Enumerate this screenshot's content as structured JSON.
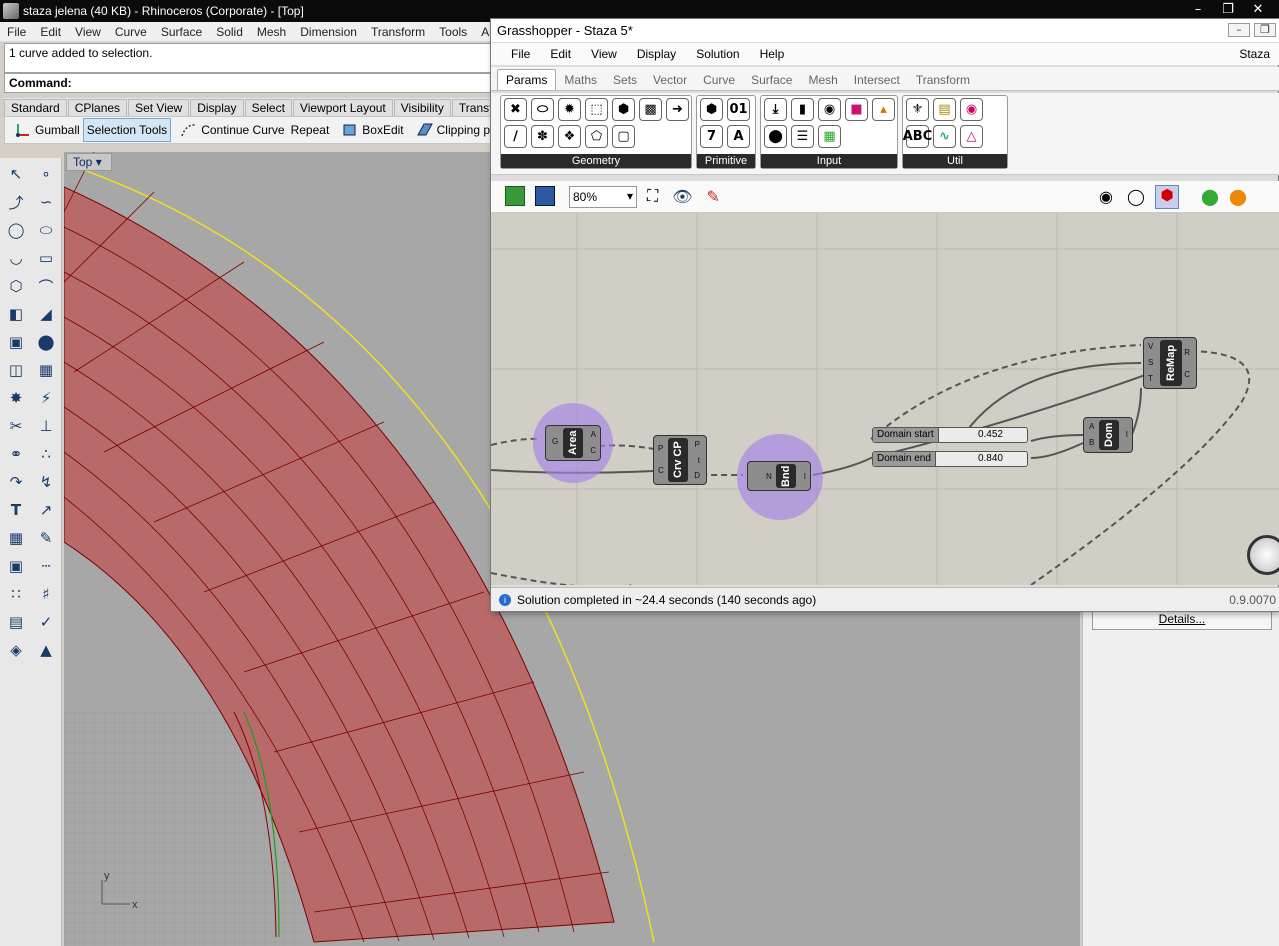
{
  "rhino": {
    "title": "staza jelena (40 KB) - Rhinoceros (Corporate) - [Top]",
    "menu": [
      "File",
      "Edit",
      "View",
      "Curve",
      "Surface",
      "Solid",
      "Mesh",
      "Dimension",
      "Transform",
      "Tools",
      "An"
    ],
    "history": "1 curve added to selection.",
    "command_label": "Command:",
    "toolbar_tabs": [
      "Standard",
      "CPlanes",
      "Set View",
      "Display",
      "Select",
      "Viewport Layout",
      "Visibility",
      "Transfor"
    ],
    "tools": {
      "gumball": "Gumball",
      "selection": "Selection Tools",
      "continue": "Continue Curve",
      "repeat": "Repeat",
      "boxedit": "BoxEdit",
      "clipping": "Clipping pl"
    },
    "viewport_tab": "Top",
    "axis_x": "x",
    "axis_y": "y",
    "details_button": "Details..."
  },
  "gh": {
    "title": "Grasshopper - Staza 5*",
    "title_right": "Staza",
    "menu": [
      "File",
      "Edit",
      "View",
      "Display",
      "Solution",
      "Help"
    ],
    "tabs": [
      "Params",
      "Maths",
      "Sets",
      "Vector",
      "Curve",
      "Surface",
      "Mesh",
      "Intersect",
      "Transform"
    ],
    "groups": [
      "Geometry",
      "Primitive",
      "Input",
      "Util"
    ],
    "zoom": "80%",
    "status": "Solution completed in ~24.4 seconds (140 seconds ago)",
    "version": "0.9.0070",
    "components": {
      "area": {
        "name": "Area",
        "in": [
          "G"
        ],
        "out": [
          "A",
          "C"
        ]
      },
      "crvcp": {
        "name": "Crv CP",
        "in": [
          "P",
          "C"
        ],
        "out": [
          "P",
          "t",
          "D"
        ]
      },
      "bnd": {
        "name": "Bnd",
        "in": [
          "N"
        ],
        "out": [
          "I"
        ]
      },
      "dom": {
        "name": "Dom",
        "in": [
          "A",
          "B"
        ],
        "out": [
          "I"
        ]
      },
      "remap": {
        "name": "ReMap",
        "in": [
          "V",
          "S",
          "T"
        ],
        "out": [
          "R",
          "C"
        ]
      }
    },
    "sliders": [
      {
        "label": "Domain start",
        "value": "0.452"
      },
      {
        "label": "Domain end",
        "value": "0.840"
      }
    ]
  }
}
